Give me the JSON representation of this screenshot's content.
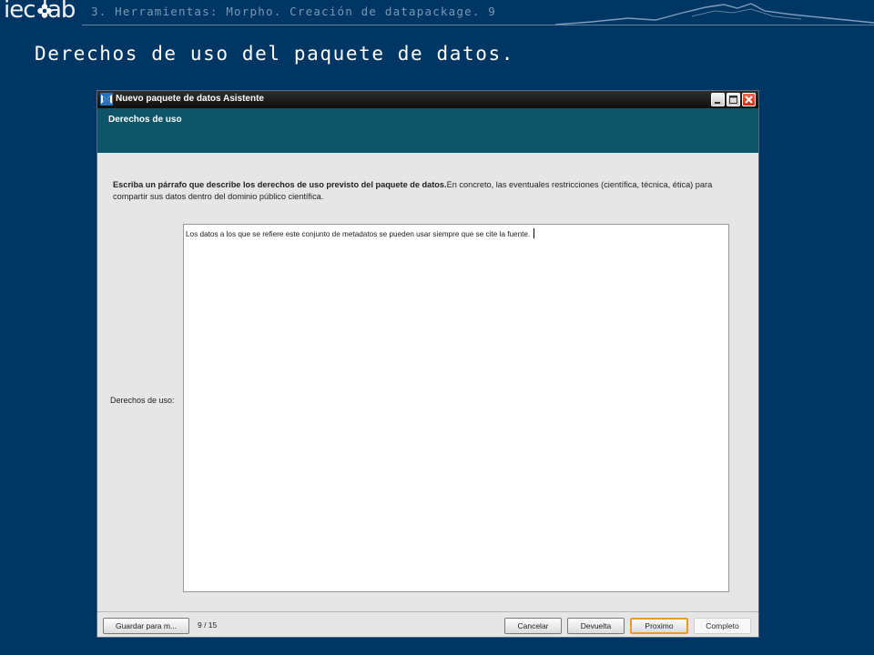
{
  "slide": {
    "logo_text": "iec lab",
    "header_title": "3. Herramientas: Morpho. Creación de datapackage. 9",
    "title": "Derechos de uso del paquete de datos."
  },
  "window": {
    "title": "Nuevo paquete de datos Asistente",
    "step_title": "Derechos de uso",
    "instructions_bold": "Escriba un párrafo que describe los derechos de uso previsto del paquete de datos.",
    "instructions_normal": "En concreto, las eventuales restricciones (científica, técnica, ética) para compartir sus datos dentro del dominio público científica.",
    "field_label": "Derechos de uso:",
    "field_value": "Los datos a los que se refiere este conjunto de metadatos se pueden usar siempre que se cite la fuente."
  },
  "footer": {
    "save_label": "Guardar para m...",
    "page_indicator": "9 / 15",
    "cancel_label": "Cancelar",
    "back_label": "Devuelta",
    "next_label": "Proximo",
    "finish_label": "Completo"
  },
  "colors": {
    "background": "#003663",
    "wizard_header": "#0f5569",
    "titlebar": "#1a1a1a",
    "next_button_border": "#e89a2a"
  },
  "icons": {
    "logo_flower": "flower-icon",
    "app_icon": "morpho-app-icon",
    "minimize": "minimize-icon",
    "maximize": "maximize-icon",
    "close": "close-icon"
  }
}
